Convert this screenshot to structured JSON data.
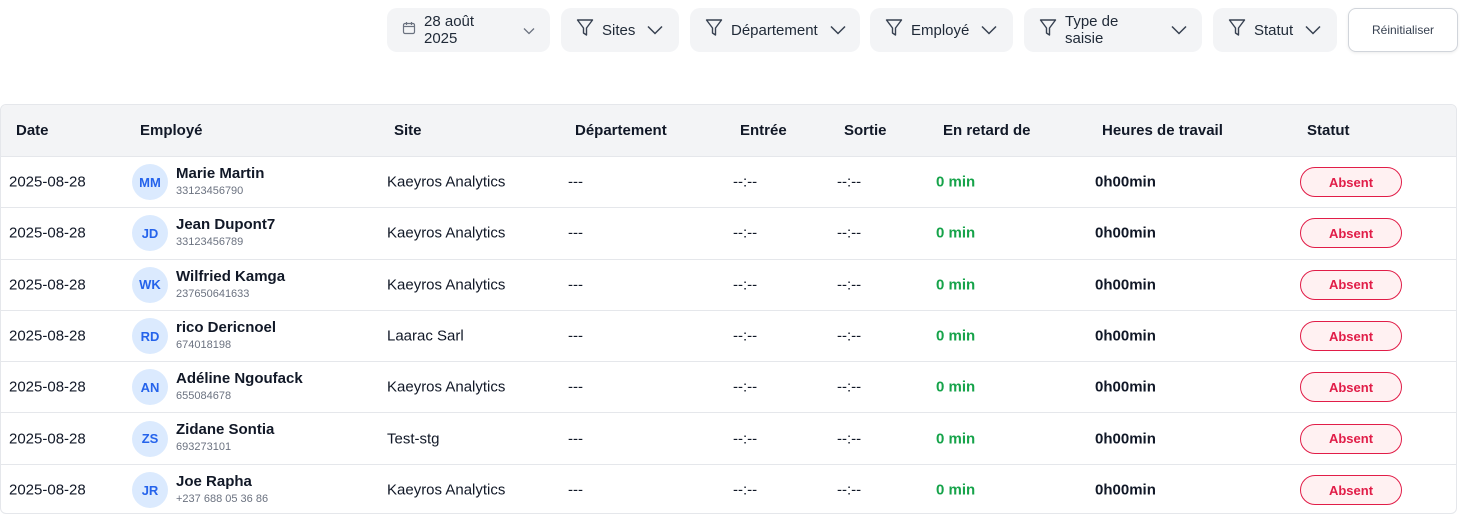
{
  "filters": {
    "date": "28 août 2025",
    "sites": "Sites",
    "department": "Département",
    "employee": "Employé",
    "entry_type": "Type de saisie",
    "status": "Statut",
    "reset": "Réinitialiser"
  },
  "columns": [
    "Date",
    "Employé",
    "Site",
    "Département",
    "Entrée",
    "Sortie",
    "En retard de",
    "Heures de travail",
    "Statut"
  ],
  "rows": [
    {
      "date": "2025-08-28",
      "initials": "MM",
      "name": "Marie Martin",
      "phone": "33123456790",
      "site": "Kaeyros Analytics",
      "department": "---",
      "in": "--:--",
      "out": "--:--",
      "late": "0 min",
      "hours": "0h00min",
      "status": "Absent"
    },
    {
      "date": "2025-08-28",
      "initials": "JD",
      "name": "Jean Dupont7",
      "phone": "33123456789",
      "site": "Kaeyros Analytics",
      "department": "---",
      "in": "--:--",
      "out": "--:--",
      "late": "0 min",
      "hours": "0h00min",
      "status": "Absent"
    },
    {
      "date": "2025-08-28",
      "initials": "WK",
      "name": "Wilfried Kamga",
      "phone": "237650641633",
      "site": "Kaeyros Analytics",
      "department": "---",
      "in": "--:--",
      "out": "--:--",
      "late": "0 min",
      "hours": "0h00min",
      "status": "Absent"
    },
    {
      "date": "2025-08-28",
      "initials": "RD",
      "name": "rico Dericnoel",
      "phone": "674018198",
      "site": "Laarac Sarl",
      "department": "---",
      "in": "--:--",
      "out": "--:--",
      "late": "0 min",
      "hours": "0h00min",
      "status": "Absent"
    },
    {
      "date": "2025-08-28",
      "initials": "AN",
      "name": "Adéline Ngoufack",
      "phone": "655084678",
      "site": "Kaeyros Analytics",
      "department": "---",
      "in": "--:--",
      "out": "--:--",
      "late": "0 min",
      "hours": "0h00min",
      "status": "Absent"
    },
    {
      "date": "2025-08-28",
      "initials": "ZS",
      "name": "Zidane Sontia",
      "phone": "693273101",
      "site": "Test-stg",
      "department": "---",
      "in": "--:--",
      "out": "--:--",
      "late": "0 min",
      "hours": "0h00min",
      "status": "Absent"
    },
    {
      "date": "2025-08-28",
      "initials": "JR",
      "name": "Joe Rapha",
      "phone": "+237 688 05 36 86",
      "site": "Kaeyros Analytics",
      "department": "---",
      "in": "--:--",
      "out": "--:--",
      "late": "0 min",
      "hours": "0h00min",
      "status": "Absent"
    }
  ],
  "colors": {
    "late": "#16a34a",
    "absent": "#e11d48",
    "avatar_bg": "#dbeafe",
    "avatar_fg": "#2563eb"
  },
  "icons": {
    "date": "calendar-icon",
    "filter": "funnel-icon",
    "dropdown": "chevron-down-icon"
  }
}
